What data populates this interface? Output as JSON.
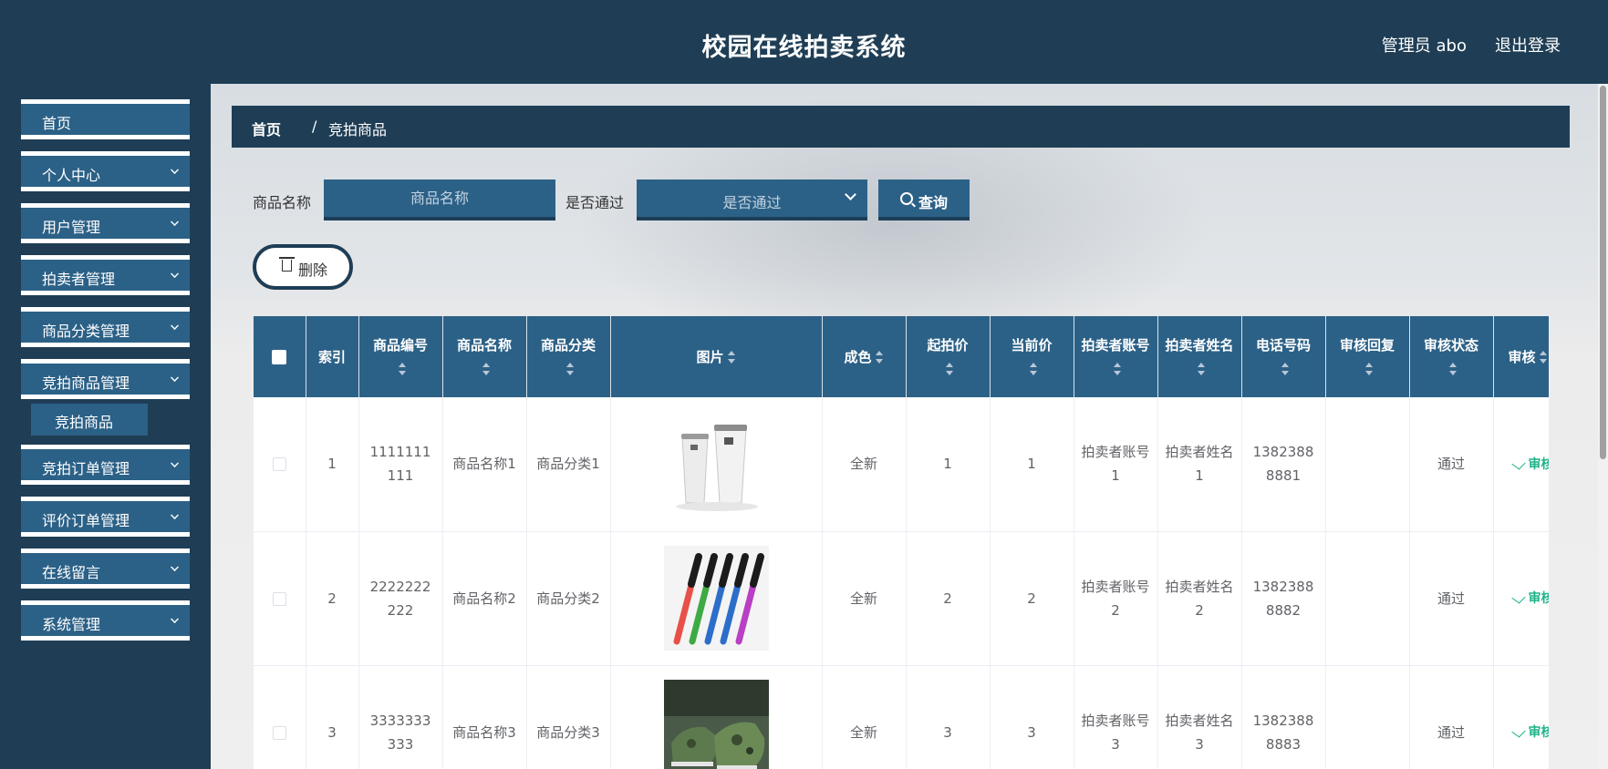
{
  "header": {
    "title": "校园在线拍卖系统",
    "user": "管理员 abo",
    "logout": "退出登录"
  },
  "sidebar": {
    "items": [
      {
        "label": "首页",
        "expandable": false
      },
      {
        "label": "个人中心",
        "expandable": true
      },
      {
        "label": "用户管理",
        "expandable": true
      },
      {
        "label": "拍卖者管理",
        "expandable": true
      },
      {
        "label": "商品分类管理",
        "expandable": true
      },
      {
        "label": "竞拍商品管理",
        "expandable": true
      },
      {
        "label": "竞拍订单管理",
        "expandable": true
      },
      {
        "label": "评价订单管理",
        "expandable": true
      },
      {
        "label": "在线留言",
        "expandable": true
      },
      {
        "label": "系统管理",
        "expandable": true
      }
    ],
    "active_sub": "竞拍商品"
  },
  "breadcrumb": {
    "home": "首页",
    "sep": "/",
    "current": "竞拍商品"
  },
  "search": {
    "name_label": "商品名称",
    "name_placeholder": "商品名称",
    "pass_label": "是否通过",
    "pass_placeholder": "是否通过",
    "query_btn": "查询"
  },
  "actions": {
    "delete_btn": "删除"
  },
  "table": {
    "headers": [
      "索引",
      "商品编号",
      "商品名称",
      "商品分类",
      "图片",
      "成色",
      "起拍价",
      "当前价",
      "拍卖者账号",
      "拍卖者姓名",
      "电话号码",
      "审核回复",
      "审核状态",
      "审核"
    ],
    "rows": [
      {
        "index": "1",
        "code": "1111111111",
        "name": "商品名称1",
        "category": "商品分类1",
        "image": "cups",
        "condition": "全新",
        "start_price": "1",
        "current_price": "1",
        "seller_account": "拍卖者账号1",
        "seller_name": "拍卖者姓名1",
        "phone": "13823888881",
        "reply": "",
        "status": "通过",
        "action": "审核"
      },
      {
        "index": "2",
        "code": "2222222222",
        "name": "商品名称2",
        "category": "商品分类2",
        "image": "toothbrushes",
        "condition": "全新",
        "start_price": "2",
        "current_price": "2",
        "seller_account": "拍卖者账号2",
        "seller_name": "拍卖者姓名2",
        "phone": "13823888882",
        "reply": "",
        "status": "通过",
        "action": "审核"
      },
      {
        "index": "3",
        "code": "3333333333",
        "name": "商品名称3",
        "category": "商品分类3",
        "image": "shoes",
        "condition": "全新",
        "start_price": "3",
        "current_price": "3",
        "seller_account": "拍卖者账号3",
        "seller_name": "拍卖者姓名3",
        "phone": "13823888883",
        "reply": "",
        "status": "通过",
        "action": "审核"
      }
    ]
  },
  "colors": {
    "header_bg": "#1f3e55",
    "primary": "#2c6187",
    "accent_green": "#1fb48a"
  }
}
